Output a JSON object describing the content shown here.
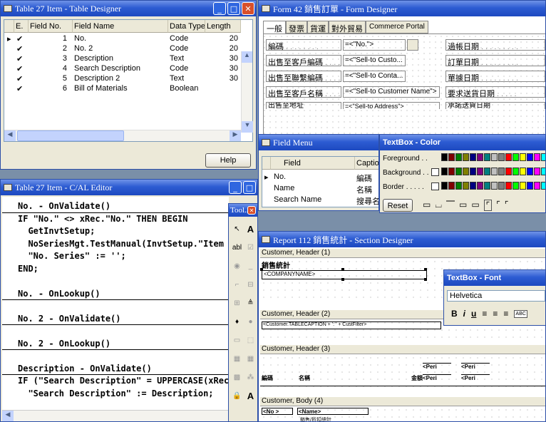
{
  "table_designer": {
    "title": "Table 27 Item - Table Designer",
    "headers": [
      "E.",
      "Field No.",
      "Field Name",
      "Data Type",
      "Length"
    ],
    "rows": [
      {
        "no": "1",
        "name": "No.",
        "type": "Code",
        "len": "20"
      },
      {
        "no": "2",
        "name": "No. 2",
        "type": "Code",
        "len": "20"
      },
      {
        "no": "3",
        "name": "Description",
        "type": "Text",
        "len": "30"
      },
      {
        "no": "4",
        "name": "Search Description",
        "type": "Code",
        "len": "30"
      },
      {
        "no": "5",
        "name": "Description 2",
        "type": "Text",
        "len": "30"
      },
      {
        "no": "6",
        "name": "Bill of Materials",
        "type": "Boolean",
        "len": ""
      }
    ],
    "help": "Help"
  },
  "cal_editor": {
    "title": "Table 27 Item - C/AL Editor",
    "lines": [
      {
        "text": "No. - OnValidate()",
        "u": true
      },
      {
        "text": "IF \"No.\" <> xRec.\"No.\" THEN BEGIN",
        "u": false
      },
      {
        "text": "  GetInvtSetup;",
        "u": false
      },
      {
        "text": "  NoSeriesMgt.TestManual(InvtSetup.\"Item Nos.",
        "u": false
      },
      {
        "text": "  \"No. Series\" := '';",
        "u": false
      },
      {
        "text": "END;",
        "u": false
      },
      {
        "text": "",
        "u": false
      },
      {
        "text": "No. - OnLookup()",
        "u": true
      },
      {
        "text": "",
        "u": false
      },
      {
        "text": "No. 2 - OnValidate()",
        "u": true
      },
      {
        "text": "",
        "u": false
      },
      {
        "text": "No. 2 - OnLookup()",
        "u": true
      },
      {
        "text": "",
        "u": false
      },
      {
        "text": "Description - OnValidate()",
        "u": true
      },
      {
        "text": "IF (\"Search Description\" = UPPERCASE(xRec.Des",
        "u": false
      },
      {
        "text": "  \"Search Description\" := Description;",
        "u": false
      }
    ]
  },
  "toolbox": {
    "title": "Tool...",
    "items": [
      "↖",
      "A",
      "abl",
      "☑",
      "◉",
      "_",
      "⌐",
      "⊟",
      "⊞",
      "≜",
      "♦",
      "●",
      "▭",
      "⬚",
      "▦",
      "▦",
      "▩",
      "⁂",
      "🔒",
      "A"
    ]
  },
  "form_designer": {
    "title": "Form 42 銷售訂單 - Form Designer",
    "tabs": [
      "一般",
      "發票",
      "貨運",
      "對外貿易",
      "Commerce Portal"
    ],
    "left_labels": [
      "編碼",
      "出售至客戶編碼",
      "出售至聯繫編碼",
      "出售至客戶名稱",
      "出售至地址"
    ],
    "left_values": [
      "=<\"No.\">",
      "=<\"Sell-to Custo...",
      "=<\"Sell-to Conta...",
      "=<\"Sell-to Customer Name\">",
      "=<\"Sell-to Address\">"
    ],
    "right_labels": [
      "過帳日期",
      "訂單日期",
      "單據日期",
      "要求送貨日期",
      "承諾送貨日期"
    ]
  },
  "field_menu": {
    "title": "Field Menu",
    "headers": [
      "Field",
      "Caption"
    ],
    "rows": [
      {
        "field": "No.",
        "caption": "編碼"
      },
      {
        "field": "Name",
        "caption": "名稱"
      },
      {
        "field": "Search Name",
        "caption": "搜尋名稱"
      }
    ]
  },
  "color_tb": {
    "title": "TextBox - Color",
    "labels": [
      "Foreground . .",
      "Background . .",
      "Border . . . . ."
    ],
    "reset": "Reset",
    "palette": [
      "#000000",
      "#800000",
      "#008000",
      "#808000",
      "#000080",
      "#800080",
      "#008080",
      "#c0c0c0",
      "#808080",
      "#ff0000",
      "#00ff00",
      "#ffff00",
      "#0000ff",
      "#ff00ff",
      "#00ffff"
    ]
  },
  "report_designer": {
    "title": "Report 112 銷售統計 - Section Designer",
    "sections": [
      "Customer, Header (1)",
      "Customer, Header (2)",
      "Customer, Header (3)",
      "Customer, Body (4)"
    ],
    "h1_title": "銷售統計",
    "h1_company": "<COMPANYNAME>",
    "h2_field": "<Customer.TABLECAPTION + ': ' + CustFilter>",
    "h3_cols": [
      "編碼",
      "名稱",
      "金額"
    ],
    "h3_periods": [
      "<Peri",
      "<Peri",
      "<Peri",
      "<Peri"
    ],
    "b4_no": "<No >",
    "b4_name": "<Name>",
    "b4_sub": "銷售/折扣總計"
  },
  "font_tb": {
    "title": "TextBox - Font",
    "font": "Helvetica",
    "buttons": [
      "B",
      "i",
      "u",
      "≡",
      "≡",
      "≡",
      "ABC"
    ]
  }
}
